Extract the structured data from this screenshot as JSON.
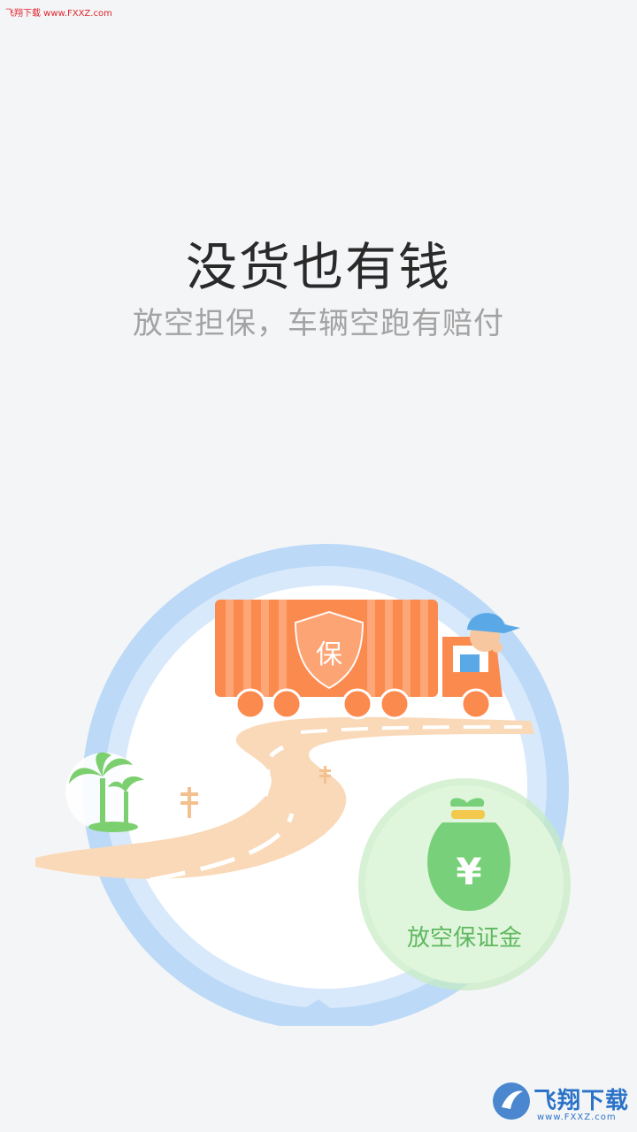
{
  "watermark_top": "飞翔下载 www.FXXZ.com",
  "title": "没货也有钱",
  "subtitle": "放空担保，车辆空跑有赔付",
  "truck_badge": "保",
  "money_symbol": "¥",
  "badge_label": "放空保证金",
  "watermark_bottom": {
    "brand": "飞翔下载",
    "url": "www.FXXZ.com"
  },
  "colors": {
    "ring": "#bcd9f7",
    "truck": "#fb8a4f",
    "road": "#f9d9b8",
    "green_badge": "#dff5dc",
    "money_bag": "#78d07a",
    "palm": "#7ccf6e"
  }
}
